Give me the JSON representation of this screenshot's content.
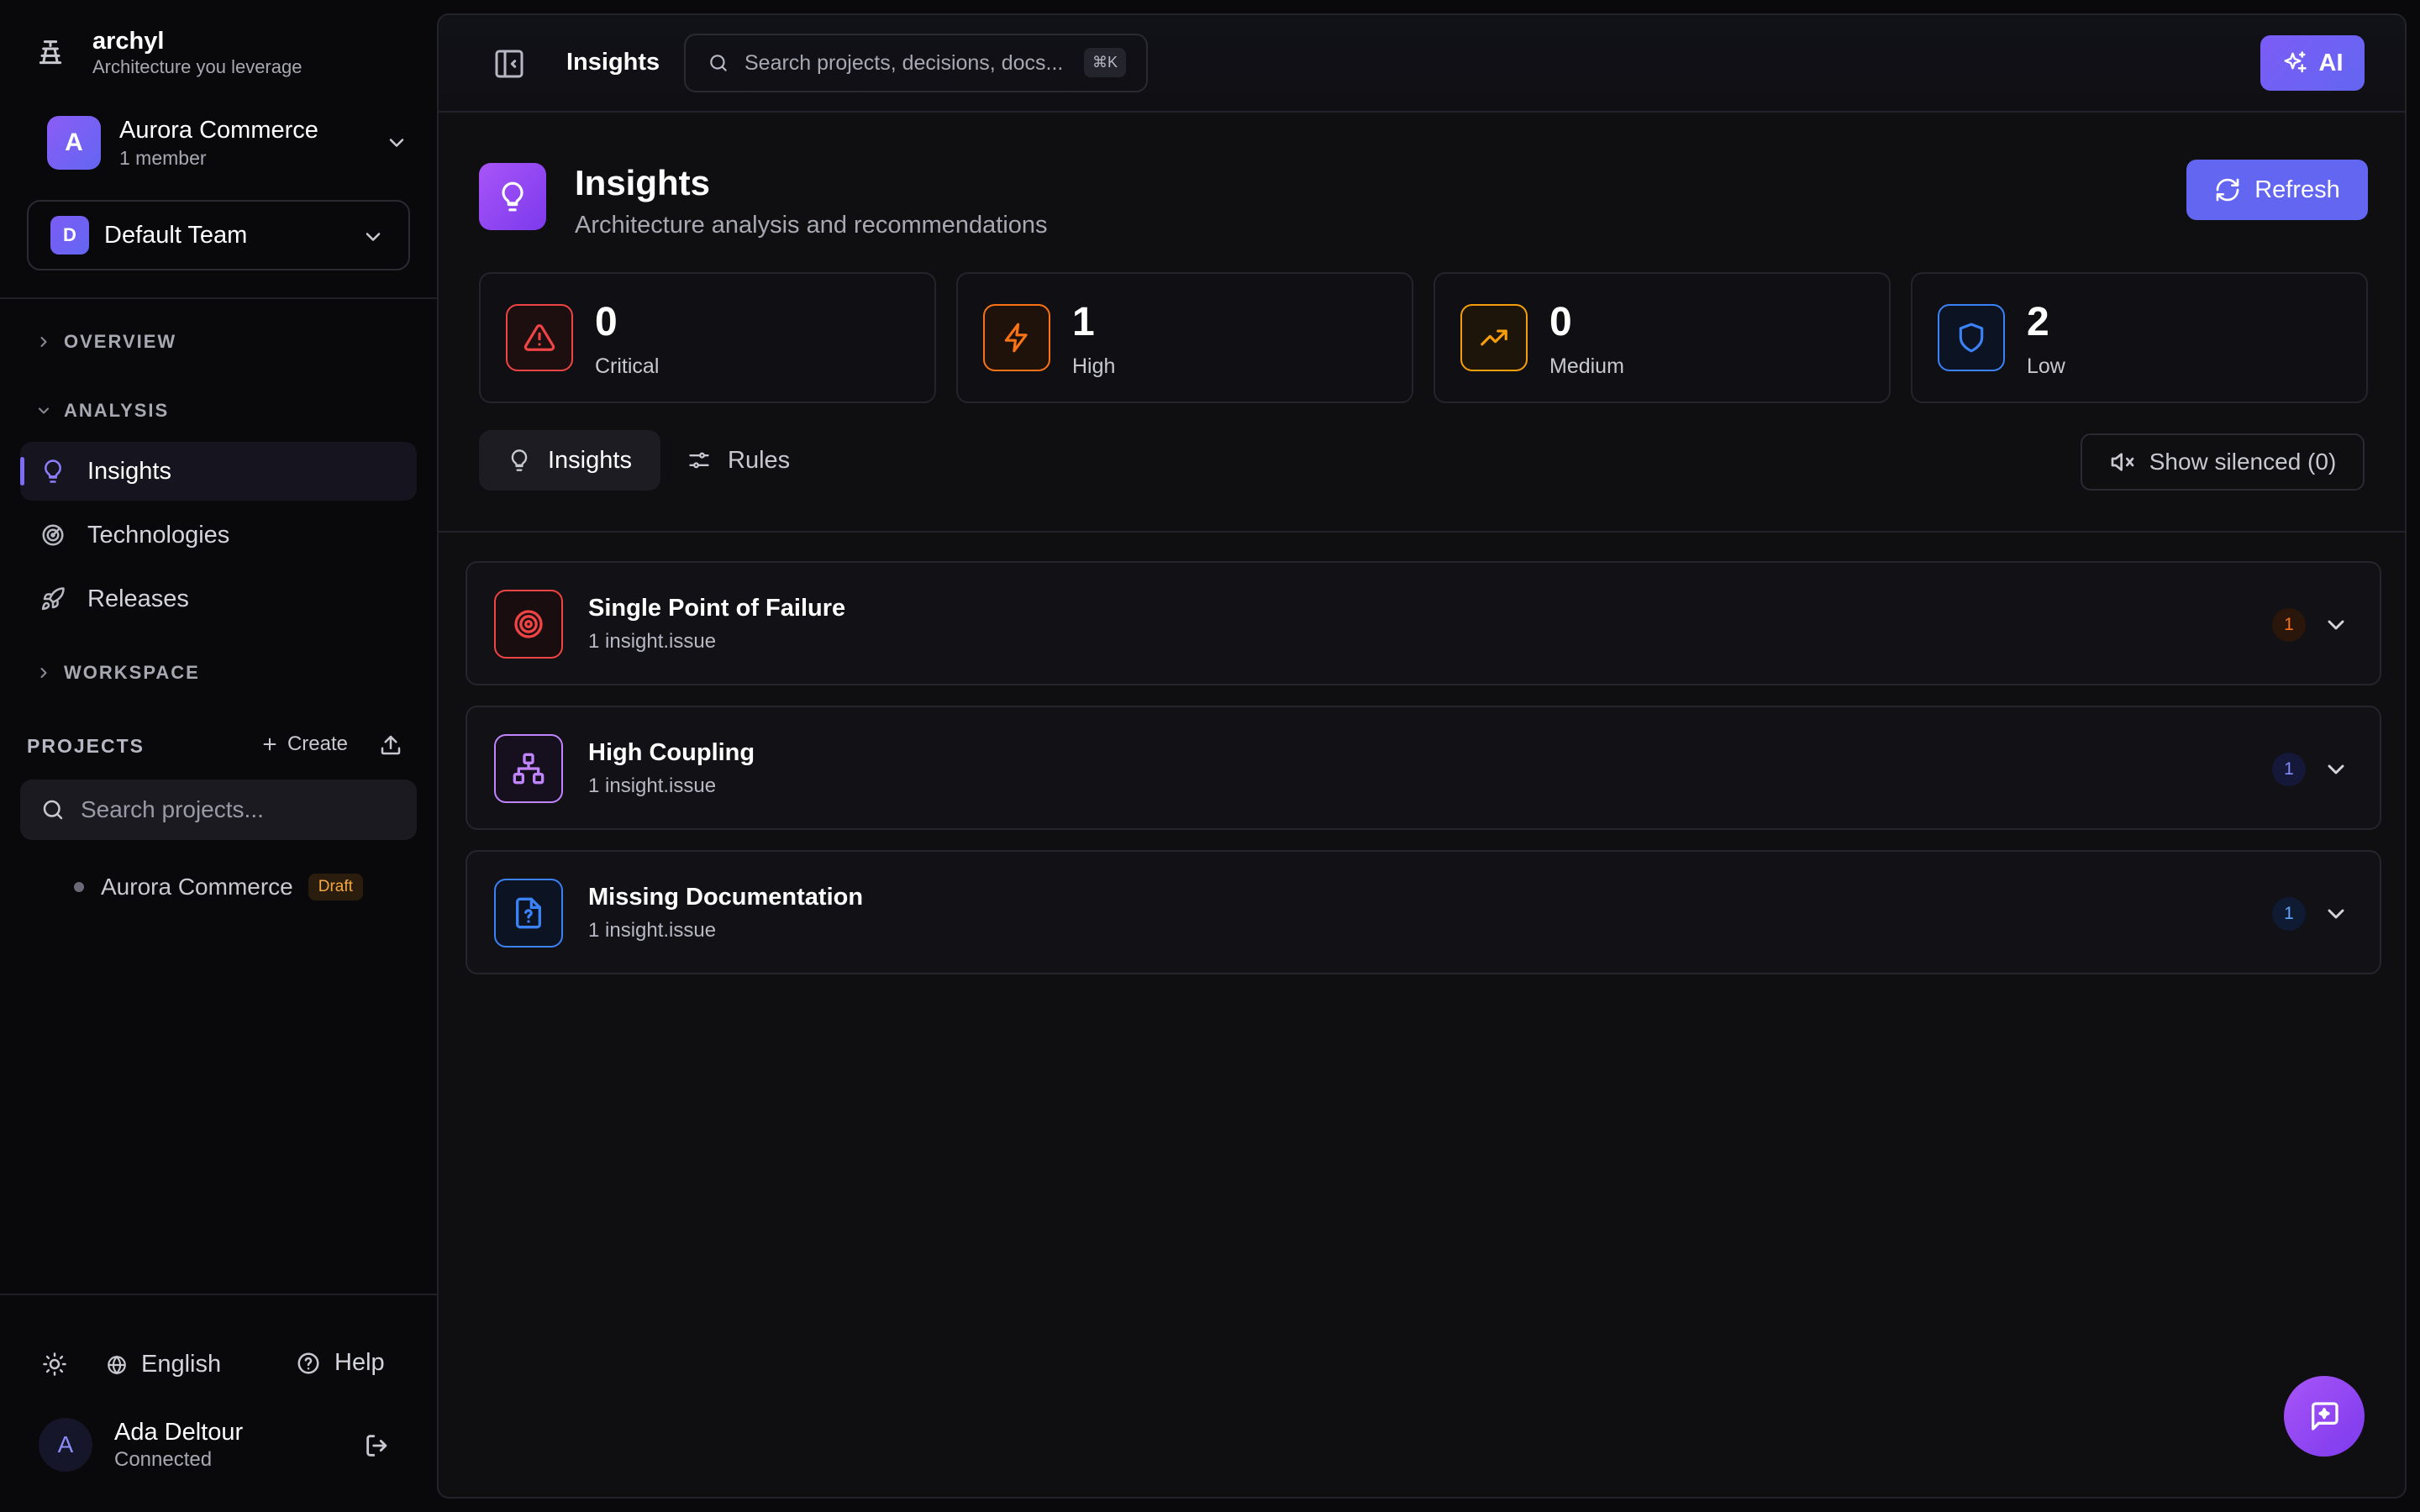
{
  "brand": {
    "name": "archyl",
    "tagline": "Architecture you leverage"
  },
  "org": {
    "initial": "A",
    "name": "Aurora Commerce",
    "members": "1 member"
  },
  "team": {
    "initial": "D",
    "name": "Default Team"
  },
  "sections": {
    "overview": "OVERVIEW",
    "analysis": "ANALYSIS",
    "workspace": "WORKSPACE"
  },
  "nav": [
    {
      "label": "Insights",
      "icon": "lightbulb-icon",
      "active": true
    },
    {
      "label": "Technologies",
      "icon": "radar-icon"
    },
    {
      "label": "Releases",
      "icon": "rocket-icon"
    }
  ],
  "projects": {
    "title": "PROJECTS",
    "create_label": "Create",
    "search_placeholder": "Search projects...",
    "items": [
      {
        "name": "Aurora Commerce",
        "badge": "Draft"
      }
    ]
  },
  "footer": {
    "language": "English",
    "help": "Help"
  },
  "user": {
    "initial": "A",
    "name": "Ada Deltour",
    "status": "Connected"
  },
  "topbar": {
    "breadcrumb": "Insights",
    "search_placeholder": "Search projects, decisions, docs...",
    "shortcut": "⌘K",
    "ai_label": "AI"
  },
  "page": {
    "title": "Insights",
    "subtitle": "Architecture analysis and recommendations",
    "refresh_label": "Refresh"
  },
  "stats": [
    {
      "value": "0",
      "label": "Critical",
      "color": "#ef4444",
      "icon": "alert-triangle-icon"
    },
    {
      "value": "1",
      "label": "High",
      "color": "#f97316",
      "icon": "zap-icon"
    },
    {
      "value": "0",
      "label": "Medium",
      "color": "#f59e0b",
      "icon": "trending-up-icon"
    },
    {
      "value": "2",
      "label": "Low",
      "color": "#3b82f6",
      "icon": "shield-icon"
    }
  ],
  "tabs": [
    {
      "label": "Insights",
      "active": true
    },
    {
      "label": "Rules"
    }
  ],
  "silenced_label": "Show silenced (0)",
  "insights": [
    {
      "title": "Single Point of Failure",
      "subtitle": "1 insight.issue",
      "count": "1",
      "color": "#ef4444",
      "count_color": "#f97316",
      "icon": "target-icon"
    },
    {
      "title": "High Coupling",
      "subtitle": "1 insight.issue",
      "count": "1",
      "color": "#c084fc",
      "count_color": "#6366f1",
      "icon": "network-icon"
    },
    {
      "title": "Missing Documentation",
      "subtitle": "1 insight.issue",
      "count": "1",
      "color": "#3b82f6",
      "count_color": "#3b82f6",
      "icon": "file-question-icon"
    }
  ]
}
